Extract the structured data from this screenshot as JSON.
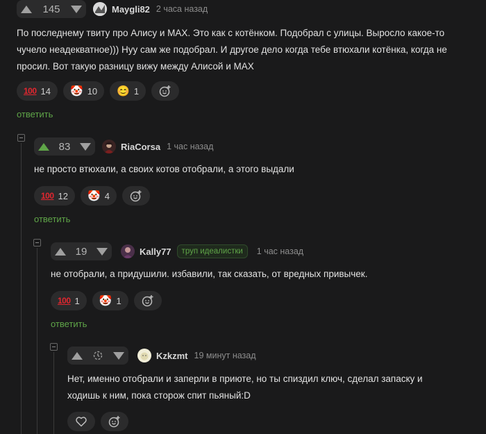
{
  "comments": [
    {
      "score": "145",
      "author": "Maygli82",
      "time": "2 часа назад",
      "text_lines": [
        "По последнему твиту про Алису и MAX. Это как с котёнком. Подобрал с улицы. Выросло какое-то",
        "чучело неадекватное))) Нуу сам же подобрал. И другое дело когда тебе втюхали котёнка, когда не",
        "просил. Вот такую разницу вижу между Алисой и MAX"
      ],
      "reactions": [
        {
          "icon": "hundred-points-icon",
          "count": "14"
        },
        {
          "icon": "clown-face-icon",
          "count": "10"
        },
        {
          "icon": "smiling-face-icon",
          "count": "1"
        }
      ],
      "reply_label": "ответить"
    },
    {
      "score": "83",
      "author": "RiaCorsa",
      "time": "1 час назад",
      "text_lines": [
        "не просто втюхали, а своих котов отобрали, а этого выдали"
      ],
      "reactions": [
        {
          "icon": "hundred-points-icon",
          "count": "12"
        },
        {
          "icon": "clown-face-icon",
          "count": "4"
        }
      ],
      "reply_label": "ответить"
    },
    {
      "score": "19",
      "author": "Kally77",
      "badge": "труп идеалистки",
      "time": "1 час назад",
      "text_lines": [
        "не отобрали, а придушили. избавили, так сказать, от вредных привычек."
      ],
      "reactions": [
        {
          "icon": "hundred-points-icon",
          "count": "1"
        },
        {
          "icon": "clown-face-icon",
          "count": "1"
        }
      ],
      "reply_label": "ответить"
    },
    {
      "author": "Kzkzmt",
      "time": "19 минут назад",
      "text_lines": [
        "Нет, именно отобрали и заперли в приюте, но ты спиздил ключ, сделал запаску и",
        "ходишь к ним, пока сторож спит пьяный:D"
      ]
    }
  ],
  "colors": {
    "background": "#1a1a1b",
    "accent_green": "#5fa548",
    "pill": "#2b2b2c"
  }
}
